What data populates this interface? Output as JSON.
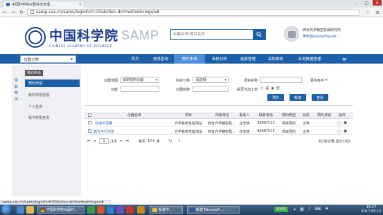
{
  "browser": {
    "tab_title": "中国科学院仪器共享管理…",
    "url": "samp.cas.cn/sams/loginFort.033Action.do?method=logon#",
    "status_url": "samp.cas.cn/sams/loginFort033Action.do?method=logon#"
  },
  "header": {
    "logo_cn": "中国科学院",
    "logo_en": "CHINESE ACADEMY OF SCIENCES",
    "brand": "SAMP",
    "search_placeholder": "仪器名称/项目名称",
    "institution": "西安光学精密机械研究所",
    "user": "黄新喆(xiaoyimyues..."
  },
  "menubar": {
    "org_select": "仪器分类",
    "items": [
      "首页",
      "信息查询",
      "预约申请",
      "审核分析",
      "结算管理",
      "采购维修",
      "业务数据管理"
    ],
    "menu_icon": "hamburger-icon"
  },
  "sidebar": {
    "vertical_tabs": [
      "导",
      "航",
      "菜",
      "单"
    ],
    "header": "预约申请",
    "items": [
      "预约申请",
      "我的供需管理",
      "个人查询",
      "我今权限查询"
    ]
  },
  "filters": {
    "labels": {
      "range": "仪器范围",
      "category": "科目分类",
      "project": "项目名称",
      "more": "更多条件",
      "function": "功能",
      "instrument": "仪器名称",
      "reserved": "是否为加工单"
    },
    "values": {
      "range": "本研究所仪器",
      "category": "-请选择-"
    },
    "radio_options": [
      "是",
      "否"
    ],
    "buttons": [
      "预约",
      "新增",
      "查看"
    ]
  },
  "table": {
    "headers": [
      "仪器名称",
      "项目",
      "所属单位",
      "联系人",
      "联系电话",
      "预约类型",
      "状态",
      "预约月结",
      "操作"
    ],
    "rows": [
      [
        "纹身不需要",
        "光学系统性能测试",
        "西安光学精密机...",
        "庄李焕",
        "88887515",
        "项目预约",
        "正常",
        ""
      ],
      [
        "激光平行光管",
        "光学系统性能测试",
        "西安光学精密机...",
        "庄李焕",
        "88887515",
        "项目预约",
        "正常",
        ""
      ]
    ]
  },
  "pager": {
    "page_value": "1",
    "total_pages": "/1页",
    "per_page_label": "每页",
    "per_page_value": "10",
    "unit": "条",
    "summary": "共2条记录,显示1到2"
  },
  "taskbar": {
    "buttons": [
      "中国科学院仪器共…",
      "新建中…",
      "新建 Microsoft …"
    ],
    "zoom": "100%",
    "time": "16:27",
    "date": "2017-05-12"
  },
  "colors": {
    "brand_blue": "#1d5fa8",
    "menu_active": "#4a8dd8",
    "link_blue": "#1d5fa8"
  }
}
